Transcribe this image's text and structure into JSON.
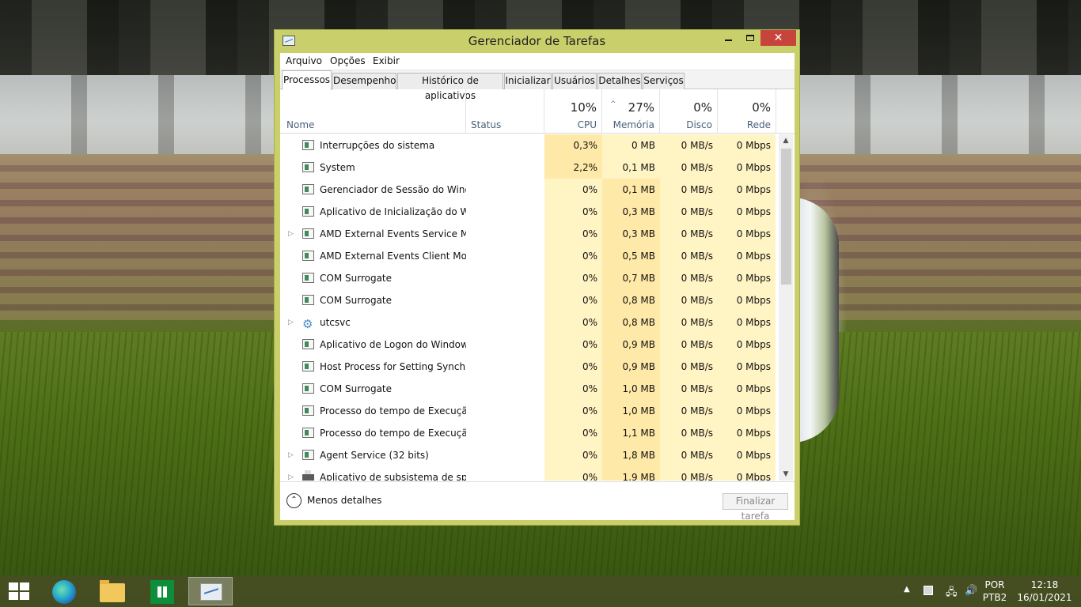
{
  "window": {
    "title": "Gerenciador de Tarefas",
    "close_glyph": "✕"
  },
  "menu": [
    "Arquivo",
    "Opções",
    "Exibir"
  ],
  "tabs": [
    "Processos",
    "Desempenho",
    "Histórico de aplicativos",
    "Inicializar",
    "Usuários",
    "Detalhes",
    "Serviços"
  ],
  "active_tab": "Processos",
  "columns": {
    "name": "Nome",
    "status": "Status",
    "cpu": {
      "label": "CPU",
      "percent": "10%"
    },
    "memory": {
      "label": "Memória",
      "percent": "27%"
    },
    "disk": {
      "label": "Disco",
      "percent": "0%"
    },
    "network": {
      "label": "Rede",
      "percent": "0%"
    }
  },
  "processes": [
    {
      "name": "Interrupções do sistema",
      "expandable": false,
      "icon": "window-icon",
      "cpu": "0,3%",
      "memory": "0 MB",
      "disk": "0 MB/s",
      "network": "0 Mbps"
    },
    {
      "name": "System",
      "expandable": false,
      "icon": "window-icon",
      "cpu": "2,2%",
      "memory": "0,1 MB",
      "disk": "0 MB/s",
      "network": "0 Mbps"
    },
    {
      "name": "Gerenciador de Sessão do Wind...",
      "expandable": false,
      "icon": "window-icon",
      "cpu": "0%",
      "memory": "0,1 MB",
      "disk": "0 MB/s",
      "network": "0 Mbps"
    },
    {
      "name": "Aplicativo de Inicialização do W...",
      "expandable": false,
      "icon": "window-icon",
      "cpu": "0%",
      "memory": "0,3 MB",
      "disk": "0 MB/s",
      "network": "0 Mbps"
    },
    {
      "name": "AMD External Events Service Mo...",
      "expandable": true,
      "icon": "window-icon",
      "cpu": "0%",
      "memory": "0,3 MB",
      "disk": "0 MB/s",
      "network": "0 Mbps"
    },
    {
      "name": "AMD External Events Client Mo...",
      "expandable": false,
      "icon": "window-icon",
      "cpu": "0%",
      "memory": "0,5 MB",
      "disk": "0 MB/s",
      "network": "0 Mbps"
    },
    {
      "name": "COM Surrogate",
      "expandable": false,
      "icon": "window-icon",
      "cpu": "0%",
      "memory": "0,7 MB",
      "disk": "0 MB/s",
      "network": "0 Mbps"
    },
    {
      "name": "COM Surrogate",
      "expandable": false,
      "icon": "window-icon",
      "cpu": "0%",
      "memory": "0,8 MB",
      "disk": "0 MB/s",
      "network": "0 Mbps"
    },
    {
      "name": "utcsvc",
      "expandable": true,
      "icon": "gear-icon",
      "cpu": "0%",
      "memory": "0,8 MB",
      "disk": "0 MB/s",
      "network": "0 Mbps"
    },
    {
      "name": "Aplicativo de Logon do Windows",
      "expandable": false,
      "icon": "window-icon",
      "cpu": "0%",
      "memory": "0,9 MB",
      "disk": "0 MB/s",
      "network": "0 Mbps"
    },
    {
      "name": "Host Process for Setting Synchr...",
      "expandable": false,
      "icon": "window-icon",
      "cpu": "0%",
      "memory": "0,9 MB",
      "disk": "0 MB/s",
      "network": "0 Mbps"
    },
    {
      "name": "COM Surrogate",
      "expandable": false,
      "icon": "window-icon",
      "cpu": "0%",
      "memory": "1,0 MB",
      "disk": "0 MB/s",
      "network": "0 Mbps"
    },
    {
      "name": "Processo do tempo de Execuçã...",
      "expandable": false,
      "icon": "window-icon",
      "cpu": "0%",
      "memory": "1,0 MB",
      "disk": "0 MB/s",
      "network": "0 Mbps"
    },
    {
      "name": "Processo do tempo de Execuçã...",
      "expandable": false,
      "icon": "window-icon",
      "cpu": "0%",
      "memory": "1,1 MB",
      "disk": "0 MB/s",
      "network": "0 Mbps"
    },
    {
      "name": "Agent Service (32 bits)",
      "expandable": true,
      "icon": "window-icon",
      "cpu": "0%",
      "memory": "1,8 MB",
      "disk": "0 MB/s",
      "network": "0 Mbps"
    },
    {
      "name": "Aplicativo de subsistema de spo...",
      "expandable": true,
      "icon": "printer-icon",
      "cpu": "0%",
      "memory": "1,9 MB",
      "disk": "0 MB/s",
      "network": "0 Mbps"
    }
  ],
  "footer": {
    "less_details": "Menos detalhes",
    "end_task": "Finalizar tarefa"
  },
  "taskbar": {
    "apps": [
      "start-icon",
      "edge-icon",
      "file-explorer-icon",
      "store-icon",
      "task-manager-icon"
    ],
    "language": "POR",
    "keyboard": "PTB2",
    "time": "12:18",
    "date": "16/01/2021"
  },
  "colors": {
    "window_frame": "#c9cf6a",
    "close_button": "#c7443d",
    "heat_light": "#fff4c4",
    "heat_mid": "#ffe9a8"
  }
}
